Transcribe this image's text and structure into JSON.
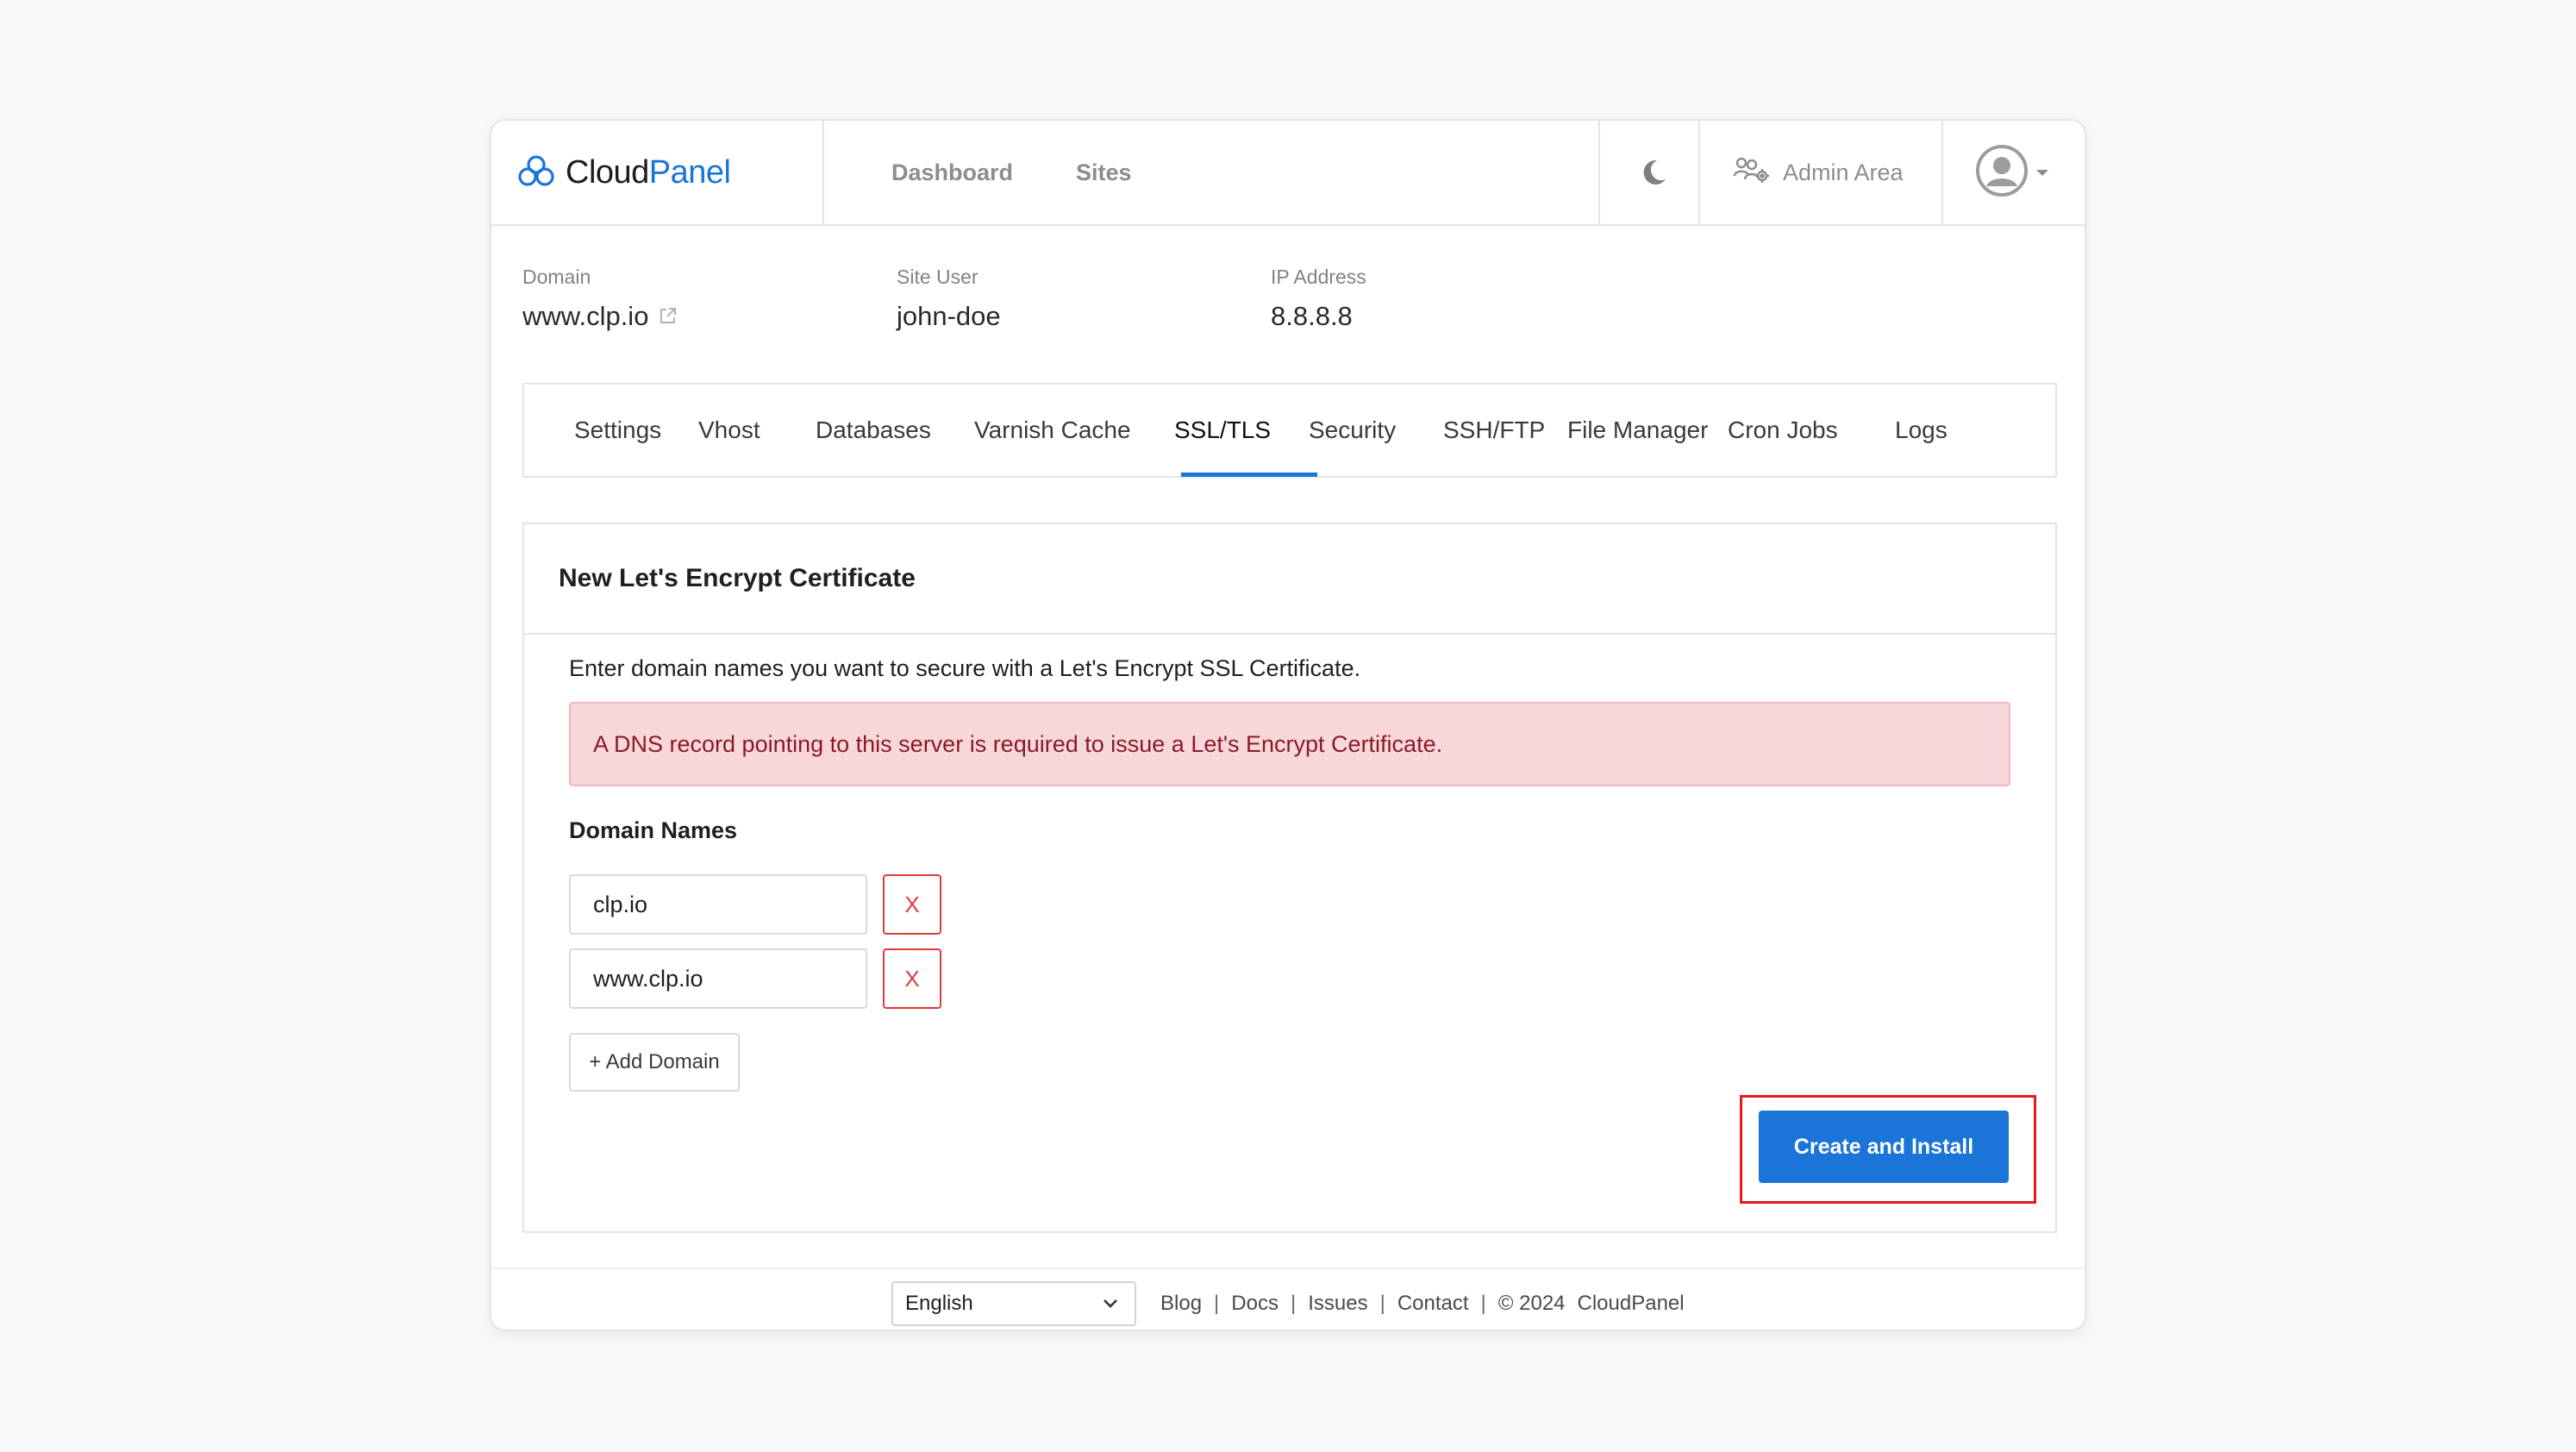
{
  "brand": {
    "name_part1": "Cloud",
    "name_part2": "Panel",
    "accent_color": "#1b74d8"
  },
  "nav": {
    "dashboard": "Dashboard",
    "sites": "Sites",
    "admin_area": "Admin Area"
  },
  "site": {
    "domain_label": "Domain",
    "domain_value": "www.clp.io",
    "site_user_label": "Site User",
    "site_user_value": "john-doe",
    "ip_label": "IP Address",
    "ip_value": "8.8.8.8"
  },
  "tabs": [
    {
      "label": "Settings"
    },
    {
      "label": "Vhost"
    },
    {
      "label": "Databases"
    },
    {
      "label": "Varnish Cache"
    },
    {
      "label": "SSL/TLS",
      "active": true
    },
    {
      "label": "Security"
    },
    {
      "label": "SSH/FTP"
    },
    {
      "label": "File Manager"
    },
    {
      "label": "Cron Jobs"
    },
    {
      "label": "Logs"
    }
  ],
  "card": {
    "title": "New Let's Encrypt Certificate",
    "intro": "Enter domain names you want to secure with a Let's Encrypt SSL Certificate.",
    "alert": "A DNS record pointing to this server is required to issue a Let's Encrypt Certificate.",
    "domain_names_label": "Domain Names",
    "domains": [
      {
        "value": "clp.io",
        "remove_label": "X"
      },
      {
        "value": "www.clp.io",
        "remove_label": "X"
      }
    ],
    "add_domain_label": "+ Add Domain",
    "submit_label": "Create and Install"
  },
  "footer": {
    "language": "English",
    "links": [
      "Blog",
      "Docs",
      "Issues",
      "Contact"
    ],
    "copyright": "© 2024",
    "company": "CloudPanel"
  },
  "icons": {
    "logo": "cloud-icon",
    "theme": "moon-icon",
    "admin": "users-gear-icon",
    "external": "external-link-icon",
    "avatar": "user-avatar-icon",
    "dropdown": "chevron-down-icon"
  }
}
